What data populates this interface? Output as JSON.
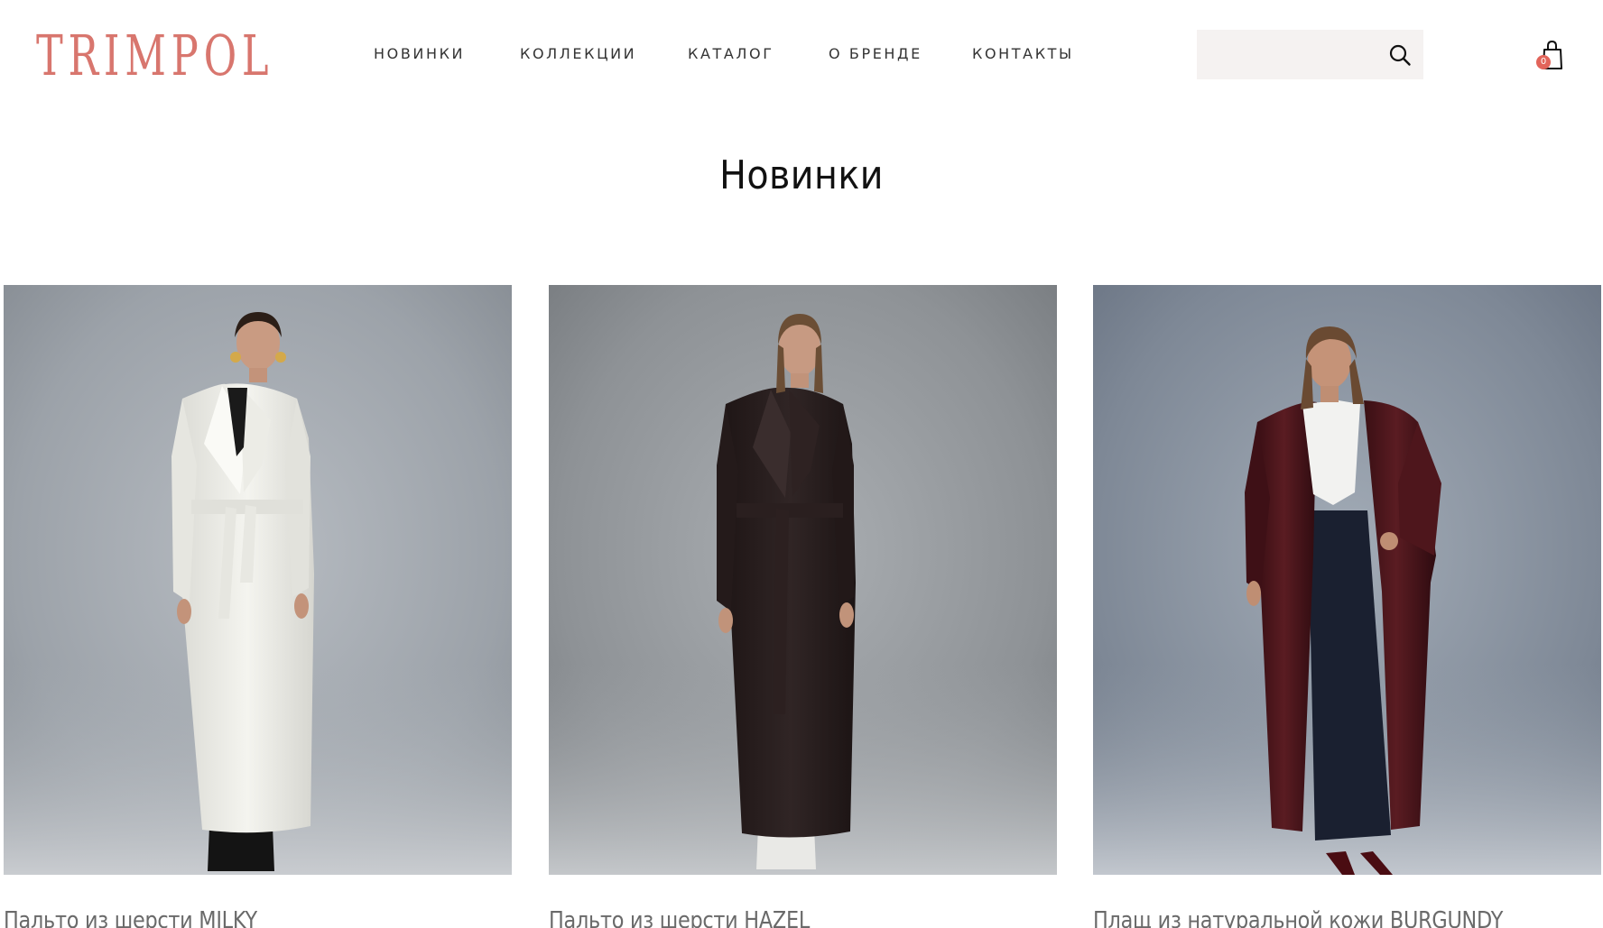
{
  "brand": {
    "logo_text": "TRIMPOL",
    "accent_color": "#d8766e"
  },
  "nav": {
    "items": [
      "НОВИНКИ",
      "КОЛЛЕКЦИИ",
      "КАТАЛОГ",
      "О БРЕНДЕ",
      "КОНТАКТЫ"
    ]
  },
  "search": {
    "placeholder": "",
    "value": "",
    "icon": "search-icon"
  },
  "cart": {
    "icon": "shopping-bag-icon",
    "count": "0",
    "badge_color": "#e2645a"
  },
  "page": {
    "title": "Новинки"
  },
  "products": [
    {
      "name": "Пальто из шерсти MILKY",
      "image": "model-white-wool-coat-photo"
    },
    {
      "name": "Пальто из шерсти HAZEL",
      "image": "model-dark-brown-wool-coat-photo"
    },
    {
      "name": "Плащ из натуральной кожи BURGUNDY",
      "image": "model-burgundy-leather-trench-photo"
    }
  ]
}
